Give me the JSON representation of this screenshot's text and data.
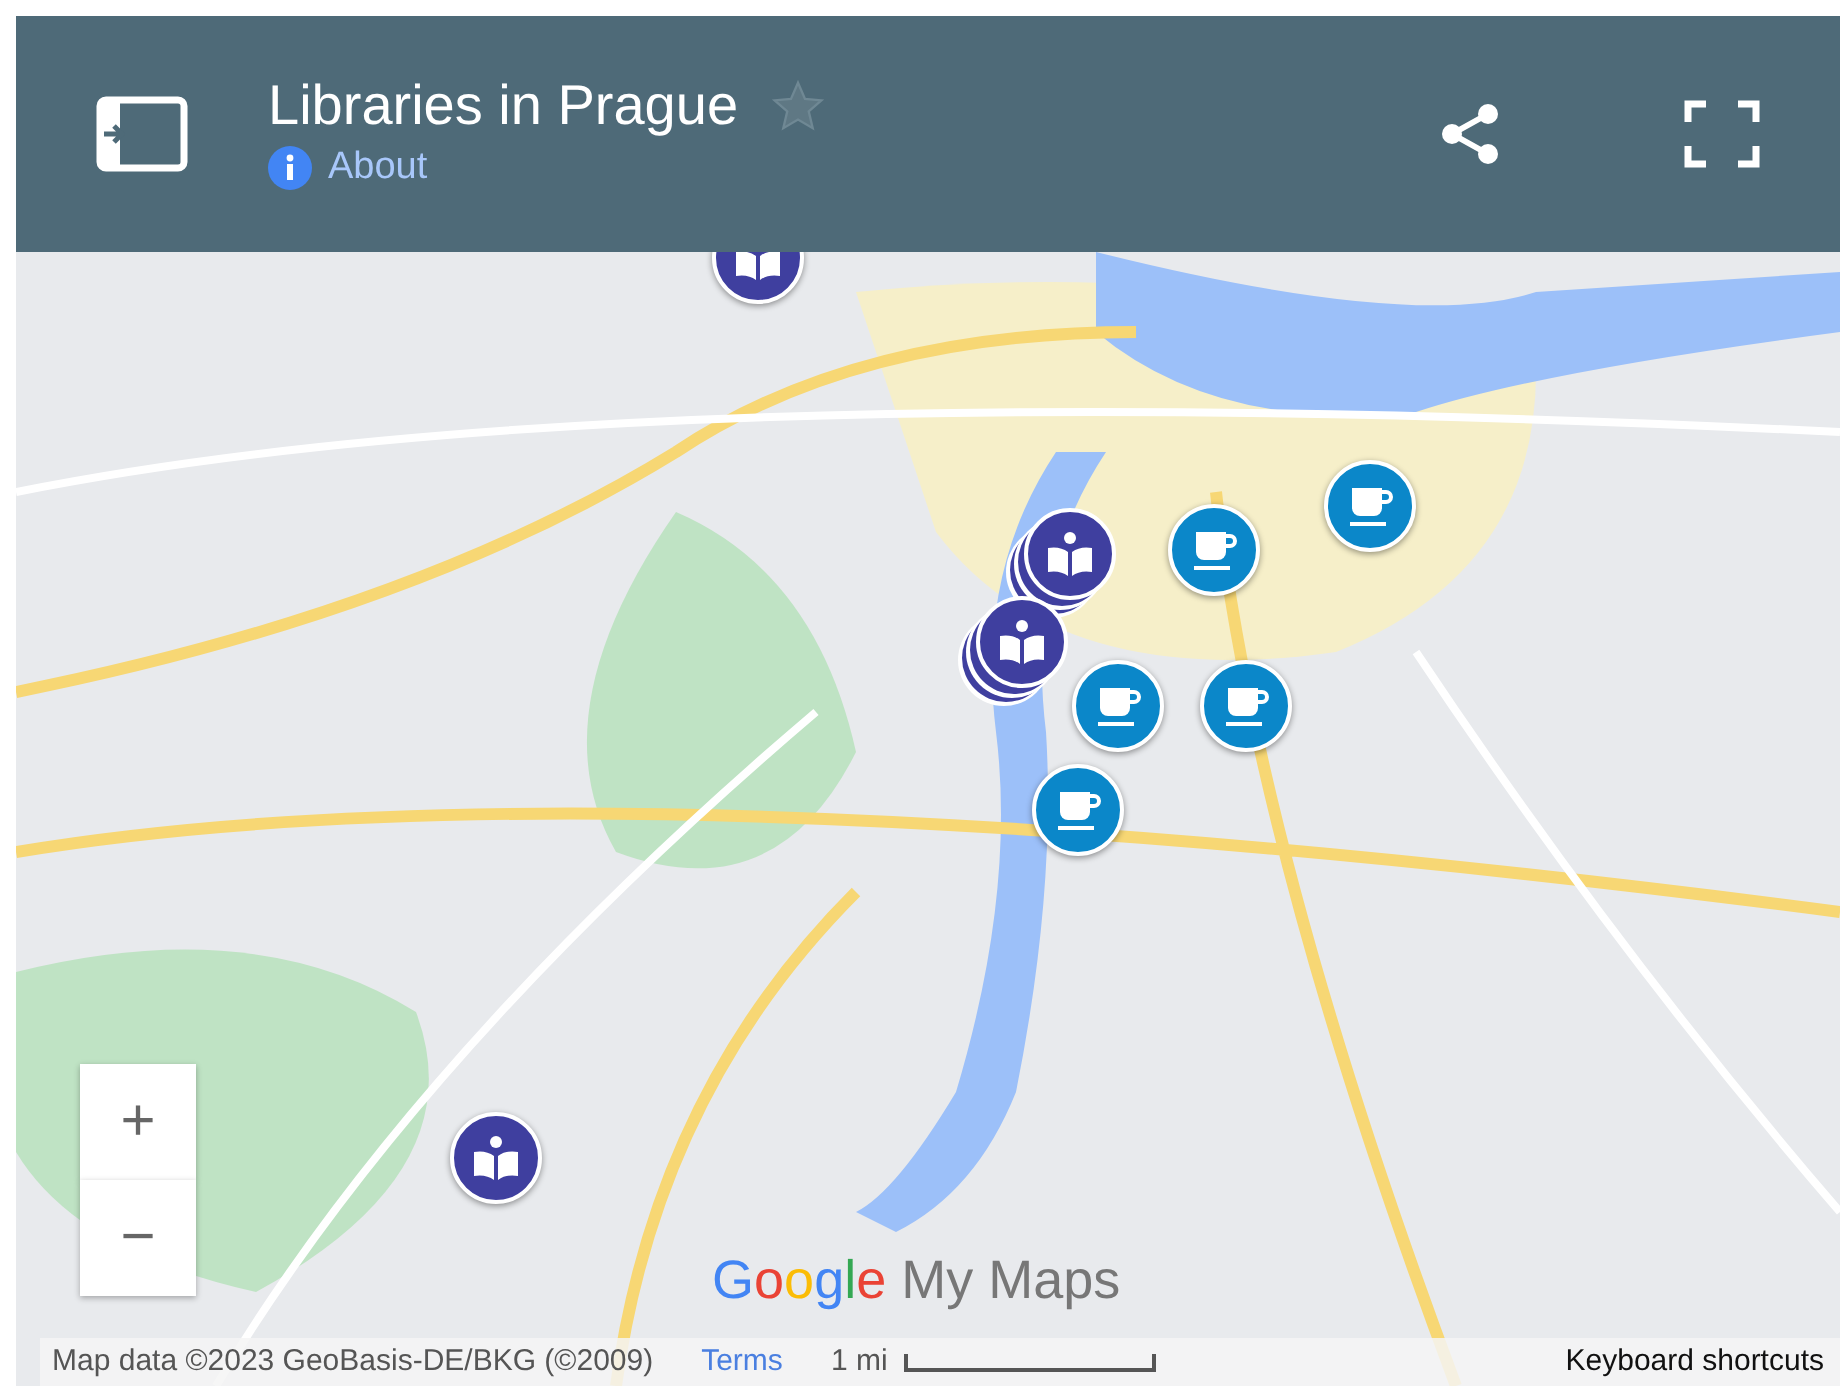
{
  "header": {
    "title": "Libraries in Prague",
    "starred": false,
    "about": "About"
  },
  "markers": [
    {
      "kind": "library",
      "stacked": false
    },
    {
      "kind": "library",
      "stacked": true
    },
    {
      "kind": "library",
      "stacked": true
    },
    {
      "kind": "library",
      "stacked": false
    },
    {
      "kind": "cafe"
    },
    {
      "kind": "cafe"
    },
    {
      "kind": "cafe"
    },
    {
      "kind": "cafe"
    },
    {
      "kind": "cafe"
    }
  ],
  "zoom": {
    "in": "+",
    "out": "−"
  },
  "logo": {
    "brand": "Google",
    "product": "My Maps"
  },
  "footer": {
    "attribution": "Map data ©2023 GeoBasis-DE/BKG (©2009)",
    "terms": "Terms",
    "scale": "1 mi",
    "shortcuts": "Keyboard shortcuts"
  }
}
